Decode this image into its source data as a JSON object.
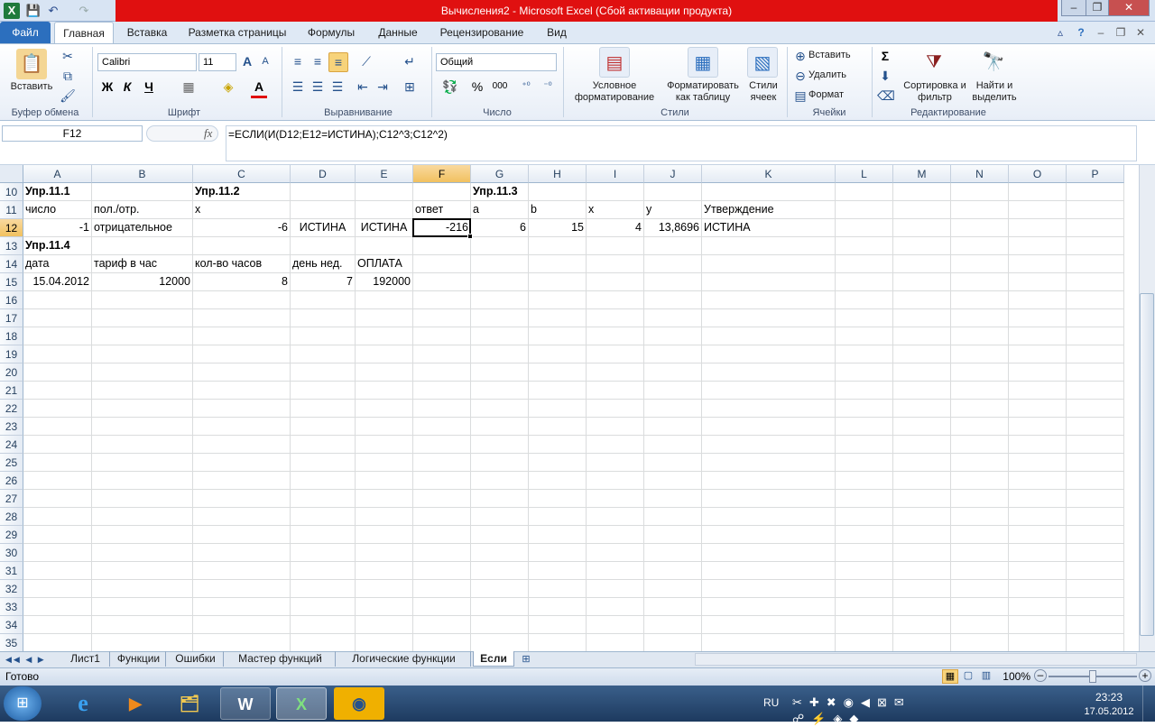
{
  "window": {
    "title": "Вычисления2  -  Microsoft Excel (Сбой активации продукта)"
  },
  "qat": {
    "save": "💾",
    "undo": "↶",
    "redo": "↷"
  },
  "window_controls": {
    "minimize": "–",
    "restore": "❐",
    "close": "✕"
  },
  "tabs": [
    {
      "label": "Файл"
    },
    {
      "label": "Главная"
    },
    {
      "label": "Вставка"
    },
    {
      "label": "Разметка страницы"
    },
    {
      "label": "Формулы"
    },
    {
      "label": "Данные"
    },
    {
      "label": "Рецензирование"
    },
    {
      "label": "Вид"
    }
  ],
  "ribbon": {
    "clipboard": {
      "paste": "Вставить",
      "group": "Буфер обмена"
    },
    "font": {
      "name": "Calibri",
      "size": "11",
      "bold": "Ж",
      "italic": "К",
      "underline": "Ч",
      "grow": "A",
      "shrink": "A",
      "color_a": "A",
      "group": "Шрифт"
    },
    "alignment": {
      "group": "Выравнивание"
    },
    "number": {
      "format": "Общий",
      "percent": "%",
      "thousands": "000",
      "group": "Число"
    },
    "styles": {
      "conditional": "Условное форматирование",
      "table": "Форматировать как таблицу",
      "cell": "Стили ячеек",
      "group": "Стили"
    },
    "cells": {
      "insert": "Вставить",
      "delete": "Удалить",
      "format": "Формат",
      "group": "Ячейки"
    },
    "editing": {
      "sigma": "Σ",
      "sort": "Сортировка и фильтр",
      "find": "Найти и выделить",
      "group": "Редактирование"
    }
  },
  "formula_bar": {
    "name_box": "F12",
    "fx": "fx",
    "formula": "=ЕСЛИ(И(D12;E12=ИСТИНА);C12^3;C12^2)"
  },
  "columns": [
    "A",
    "B",
    "C",
    "D",
    "E",
    "F",
    "G",
    "H",
    "I",
    "J",
    "K",
    "L",
    "M",
    "N",
    "O",
    "P"
  ],
  "rows": [
    "10",
    "11",
    "12",
    "13",
    "14",
    "15",
    "16",
    "17",
    "18",
    "19",
    "20",
    "21",
    "22",
    "23",
    "24",
    "25",
    "26",
    "27",
    "28",
    "29",
    "30",
    "31",
    "32",
    "33",
    "34",
    "35"
  ],
  "cells": {
    "A10": "Упр.11.1",
    "C10": "Упр.11.2",
    "G10": "Упр.11.3",
    "A11": "число",
    "B11": "пол./отр.",
    "C11": "x",
    "F11": "ответ",
    "G11": "a",
    "H11": "b",
    "I11": "x",
    "J11": "y",
    "K11": "Утверждение",
    "A12": "-1",
    "B12": "отрицательное",
    "C12": "-6",
    "D12": "ИСТИНА",
    "E12": "ИСТИНА",
    "F12": "-216",
    "G12": "6",
    "H12": "15",
    "I12": "4",
    "J12": "13,8696",
    "K12": "ИСТИНА",
    "A13": "Упр.11.4",
    "A14": "дата",
    "B14": "тариф в час",
    "C14": "кол-во часов",
    "D14": "день нед.",
    "E14": "ОПЛАТА",
    "A15": "15.04.2012",
    "B15": "12000",
    "C15": "8",
    "D15": "7",
    "E15": "192000"
  },
  "sheets": [
    "Лист1",
    "Функции",
    "Ошибки",
    "Мастер функций",
    "Логические функции",
    "Если"
  ],
  "status": {
    "ready": "Готово",
    "zoom": "100%"
  },
  "taskbar": {
    "lang": "RU",
    "time": "23:23",
    "date": "17.05.2012"
  }
}
